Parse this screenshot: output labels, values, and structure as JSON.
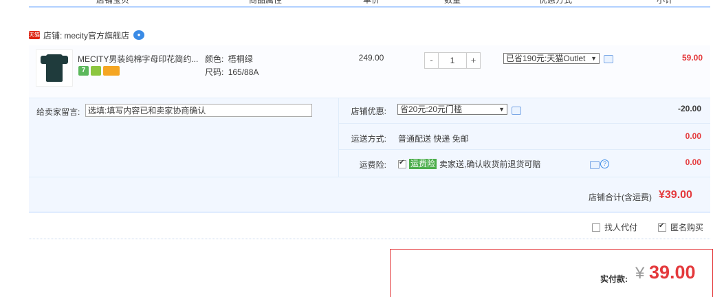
{
  "header": {
    "columns": [
      "店铺宝贝",
      "商品属性",
      "单价",
      "数量",
      "优惠方式",
      "小计"
    ]
  },
  "shop": {
    "badge": "天猫",
    "prefix": "店铺:",
    "name": "mecity官方旗舰店"
  },
  "item": {
    "title": "MECITY男装纯棉字母印花简约...",
    "color_label": "颜色:",
    "color_value": "梧桐绿",
    "size_label": "尺码:",
    "size_value": "165/88A",
    "price": "249.00",
    "qty_minus": "-",
    "qty": "1",
    "qty_plus": "+",
    "discount": "已省190元:天猫Outlet",
    "subtotal": "59.00",
    "service_icons": [
      "7-day-return-icon",
      "quality-guarantee-icon",
      "credit-card-icon"
    ]
  },
  "memo": {
    "label": "给卖家留言:",
    "placeholder": "选填:填写内容已和卖家协商确认"
  },
  "shop_discount": {
    "label": "店铺优惠:",
    "value": "省20元:20元门槛",
    "amount": "-20.00"
  },
  "shipping": {
    "label": "运送方式:",
    "value": "普通配送 快递 免邮",
    "amount": "0.00"
  },
  "insurance": {
    "label": "运费险:",
    "tag": "运费险",
    "desc": "卖家送,确认收货前退货可赔",
    "amount": "0.00"
  },
  "shop_total": {
    "label": "店铺合计(含运费)",
    "amount": "¥39.00"
  },
  "options": {
    "proxy_pay": "找人代付",
    "anonymous": "匿名购买"
  },
  "payment": {
    "label": "实付款:",
    "currency": "¥",
    "amount": "39.00"
  },
  "colors": {
    "accent_red": "#e4393c",
    "border_blue": "#b2d1ff",
    "panel_bg": "#f2f7ff"
  }
}
